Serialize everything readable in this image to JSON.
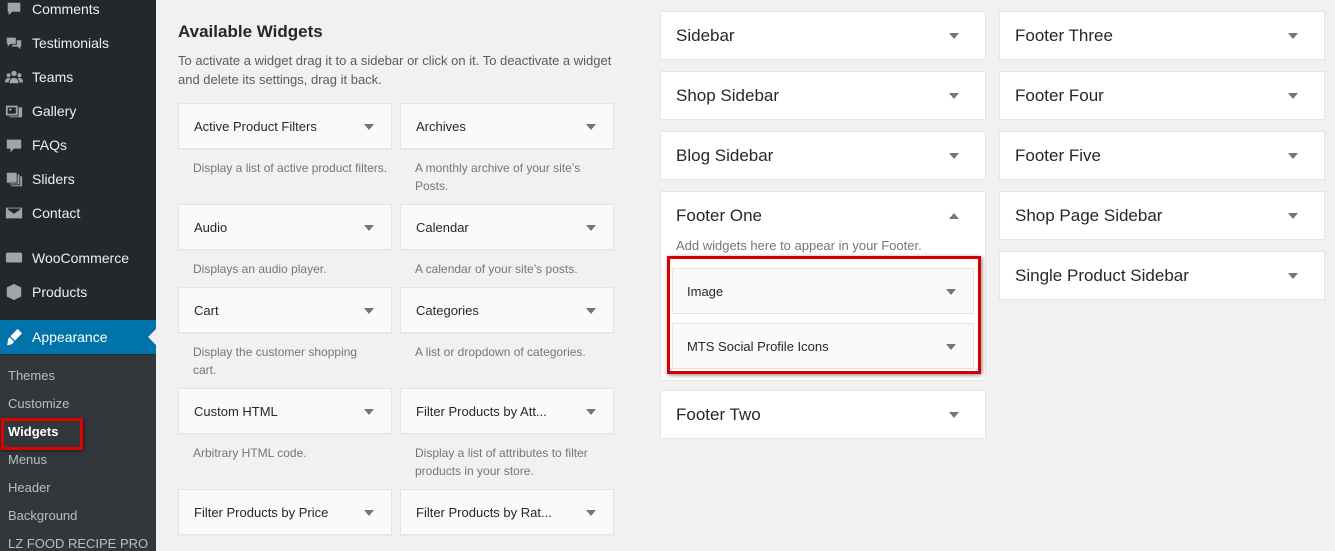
{
  "admin_menu": {
    "items": [
      {
        "label": "Comments",
        "icon": "comments-icon"
      },
      {
        "label": "Testimonials",
        "icon": "testimonials-icon"
      },
      {
        "label": "Teams",
        "icon": "teams-icon"
      },
      {
        "label": "Gallery",
        "icon": "gallery-icon"
      },
      {
        "label": "FAQs",
        "icon": "faqs-icon"
      },
      {
        "label": "Sliders",
        "icon": "sliders-icon"
      },
      {
        "label": "Contact",
        "icon": "contact-icon"
      },
      {
        "label": "WooCommerce",
        "icon": "woocommerce-icon"
      },
      {
        "label": "Products",
        "icon": "products-icon"
      },
      {
        "label": "Appearance",
        "icon": "appearance-icon"
      }
    ],
    "submenu": [
      "Themes",
      "Customize",
      "Widgets",
      "Menus",
      "Header",
      "Background",
      "LZ FOOD RECIPE PRO"
    ],
    "active_submenu": "Widgets",
    "accent_color": "#0073aa",
    "highlight_color": "#e00000"
  },
  "available_widgets": {
    "title": "Available Widgets",
    "description": "To activate a widget drag it to a sidebar or click on it. To deactivate a widget and delete its settings, drag it back.",
    "widgets": [
      {
        "title": "Active Product Filters",
        "desc": "Display a list of active product filters."
      },
      {
        "title": "Archives",
        "desc": "A monthly archive of your site’s Posts."
      },
      {
        "title": "Audio",
        "desc": "Displays an audio player."
      },
      {
        "title": "Calendar",
        "desc": "A calendar of your site’s posts."
      },
      {
        "title": "Cart",
        "desc": "Display the customer shopping cart."
      },
      {
        "title": "Categories",
        "desc": "A list or dropdown of categories."
      },
      {
        "title": "Custom HTML",
        "desc": "Arbitrary HTML code."
      },
      {
        "title": "Filter Products by Att...",
        "desc": "Display a list of attributes to filter products in your store."
      },
      {
        "title": "Filter Products by Price",
        "desc": ""
      },
      {
        "title": "Filter Products by Rat...",
        "desc": ""
      }
    ]
  },
  "sidebars": {
    "left": [
      "Sidebar",
      "Shop Sidebar",
      "Blog Sidebar"
    ],
    "footer_one": {
      "title": "Footer One",
      "desc": "Add widgets here to appear in your Footer.",
      "widgets": [
        "Image",
        "MTS Social Profile Icons"
      ]
    },
    "footer_two": "Footer Two",
    "right": [
      "Footer Three",
      "Footer Four",
      "Footer Five",
      "Shop Page Sidebar",
      "Single Product Sidebar"
    ]
  }
}
